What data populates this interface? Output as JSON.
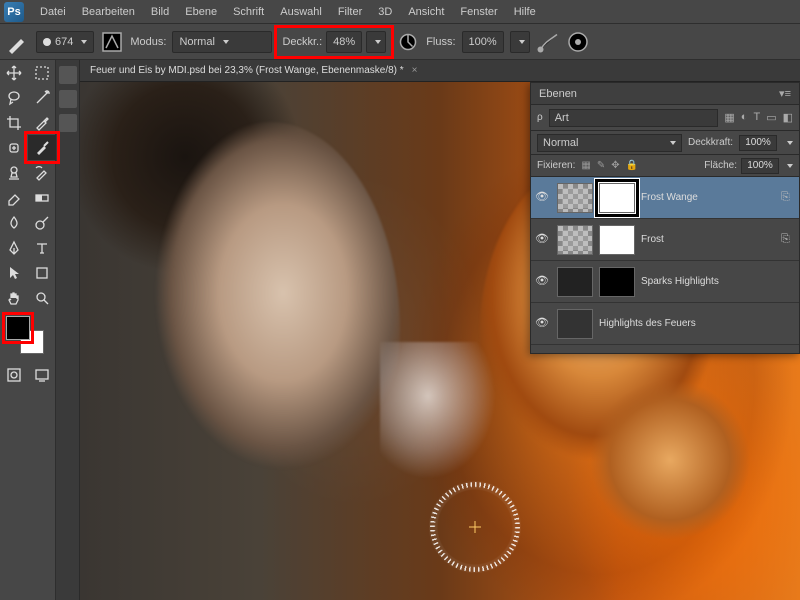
{
  "menu": [
    "Datei",
    "Bearbeiten",
    "Bild",
    "Ebene",
    "Schrift",
    "Auswahl",
    "Filter",
    "3D",
    "Ansicht",
    "Fenster",
    "Hilfe"
  ],
  "optbar": {
    "brush_size": "674",
    "mode_label": "Modus:",
    "mode_value": "Normal",
    "opacity_label": "Deckkr.:",
    "opacity_value": "48%",
    "flow_label": "Fluss:",
    "flow_value": "100%"
  },
  "doc_tab": {
    "title": "Feuer und Eis by MDI.psd bei 23,3% (Frost Wange, Ebenenmaske/8) *"
  },
  "swatch": {
    "fg": "#000000",
    "bg": "#ffffff"
  },
  "layers_panel": {
    "title": "Ebenen",
    "filter_label": "Art",
    "blend_mode": "Normal",
    "opacity_label": "Deckkraft:",
    "opacity_value": "100%",
    "lock_label": "Fixieren:",
    "fill_label": "Fläche:",
    "fill_value": "100%",
    "layers": [
      {
        "name": "Frost Wange",
        "selected": true,
        "mask_selected": true
      },
      {
        "name": "Frost",
        "selected": false
      },
      {
        "name": "Sparks Highlights",
        "selected": false,
        "dark_mask": true
      },
      {
        "name": "Highlights des Feuers",
        "selected": false
      }
    ]
  },
  "highlights": {
    "opacity_box": true,
    "brush_tool": true,
    "fg_swatch": true,
    "mask_thumb": true
  }
}
